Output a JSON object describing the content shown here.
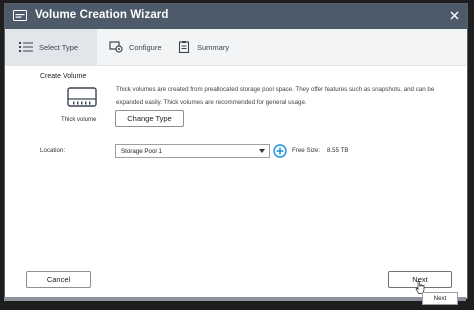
{
  "window": {
    "title": "Volume Creation Wizard",
    "close_icon": "close-icon",
    "app_icon": "wizard-icon"
  },
  "steps": [
    {
      "label": "Select Type",
      "icon": "list-icon",
      "active": true
    },
    {
      "label": "Configure",
      "icon": "settings-icon",
      "active": false
    },
    {
      "label": "Summary",
      "icon": "clipboard-icon",
      "active": false
    }
  ],
  "create_volume": {
    "section_title": "Create Volume",
    "type_label": "Thick volume",
    "type_icon": "hard-drive-icon",
    "description": "Thick volumes are created from preallocated storage pool space. They offer features such as snapshots, and can be expanded easily. Thick volumes are recommended for general usage.",
    "change_type_label": "Change Type"
  },
  "location": {
    "label": "Location:",
    "selected": "Storage Pool 1",
    "add_icon": "plus-circle-icon",
    "free_size_label": "Free Size:",
    "free_size_value": "8.55 TB"
  },
  "footer": {
    "cancel_label": "Cancel",
    "next_label": "Next",
    "tooltip": "Next"
  },
  "colors": {
    "titlebar": "#4d5a69",
    "stepbar": "#f3f4f5",
    "active_step": "#e2e5e9",
    "accent": "#1d8fe1"
  }
}
